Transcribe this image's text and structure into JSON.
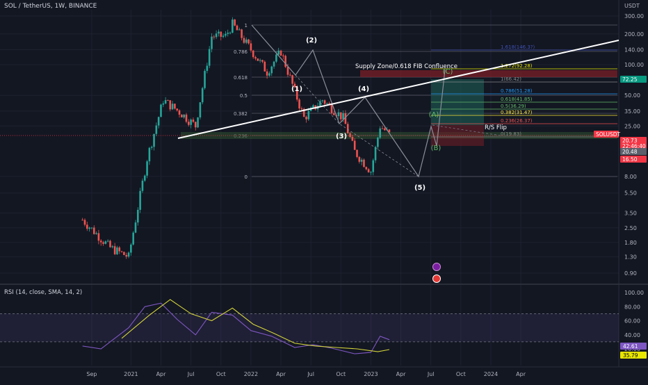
{
  "header": {
    "title": "SOL / TetherUS, 1W, BINANCE",
    "price_unit": "USDT",
    "rsi_title": "RSI (14, close, SMA, 14, 2)"
  },
  "colors": {
    "bg": "#131722",
    "grid": "#1e2230",
    "up": "#26a69a",
    "down": "#ef5350",
    "axis_text": "#b2b5be",
    "rsi_line": "#7e57c2",
    "rsi_ma": "#d4d43a",
    "trend": "#ffffff",
    "wave": "#8a8e99"
  },
  "chart_data": [
    {
      "type": "candlestick",
      "title": "SOL / TetherUS, 1W, BINANCE",
      "y_scale": "log",
      "ylim": [
        0.75,
        330
      ],
      "y_ticks": [
        "300.00",
        "200.00",
        "140.00",
        "100.00",
        "50.00",
        "35.00",
        "25.00",
        "8.00",
        "5.50",
        "3.50",
        "2.50",
        "1.80",
        "1.30",
        "0.90"
      ],
      "x_ticks": [
        "Sep",
        "2021",
        "Apr",
        "Jul",
        "Oct",
        "2022",
        "Apr",
        "Jul",
        "Oct",
        "2023",
        "Apr",
        "Jul",
        "Oct",
        "2024",
        "Apr"
      ],
      "key_prices": [
        {
          "t": "2020-08-10",
          "price": 3.0
        },
        {
          "t": "2020-11-02",
          "price": 1.6
        },
        {
          "t": "2020-12-28",
          "price": 1.3
        },
        {
          "t": "2021-01-18",
          "price": 3.0
        },
        {
          "t": "2021-02-22",
          "price": 12
        },
        {
          "t": "2021-04-12",
          "price": 45
        },
        {
          "t": "2021-06-07",
          "price": 33
        },
        {
          "t": "2021-07-19",
          "price": 25
        },
        {
          "t": "2021-09-06",
          "price": 190
        },
        {
          "t": "2021-10-18",
          "price": 190
        },
        {
          "t": "2021-11-08",
          "price": 250
        },
        {
          "t": "2022-01-03",
          "price": 140
        },
        {
          "t": "2022-02-21",
          "price": 85
        },
        {
          "t": "2022-04-04",
          "price": 135
        },
        {
          "t": "2022-06-13",
          "price": 30
        },
        {
          "t": "2022-08-08",
          "price": 45
        },
        {
          "t": "2022-10-10",
          "price": 30
        },
        {
          "t": "2022-11-14",
          "price": 14
        },
        {
          "t": "2023-01-02",
          "price": 9
        },
        {
          "t": "2023-01-30",
          "price": 25
        },
        {
          "t": "2023-02-27",
          "price": 20.73
        }
      ],
      "fib_retracement": [
        {
          "level": "1",
          "label": "1"
        },
        {
          "level": "0.786",
          "label": "0.786"
        },
        {
          "level": "0.618",
          "label": "0.618"
        },
        {
          "level": "0.5",
          "label": "0.5"
        },
        {
          "level": "0.382",
          "label": "0.382"
        },
        {
          "level": "0.236",
          "label": "0.236"
        },
        {
          "level": "0",
          "label": "0"
        }
      ],
      "fib_extension": [
        {
          "label": "1.618(146.3?)",
          "price": 146.3,
          "color": "#3f51b5"
        },
        {
          "label": "1.272(92.28)",
          "price": 92.28,
          "color": "#e6e600"
        },
        {
          "label": "1(66.42)",
          "price": 66.42,
          "color": "#888888"
        },
        {
          "label": "0.786(51.28)",
          "price": 51.28,
          "color": "#2196f3"
        },
        {
          "label": "0.618(41.85)",
          "price": 41.85,
          "color": "#66bb6a"
        },
        {
          "label": "0.5(36.29)",
          "price": 36.29,
          "color": "#66bb6a"
        },
        {
          "label": "0.382(31.47)",
          "price": 31.47,
          "color": "#ffeb3b"
        },
        {
          "label": "0.236(26.37)",
          "price": 26.37,
          "color": "#ef5350"
        },
        {
          "label": "0(19.83)",
          "price": 19.83,
          "color": "#888888"
        }
      ],
      "annotations": {
        "supply_zone": "Supply Zone/0.618 FIB Confluence",
        "rs_flip": "R/S Flip",
        "waves": [
          "(1)",
          "(2)",
          "(3)",
          "(4)",
          "(5)"
        ],
        "corrective": [
          "(A)",
          "(B)",
          "(C)"
        ]
      },
      "price_badges": [
        {
          "label": "72.25",
          "price": 72.25,
          "color": "#089981"
        },
        {
          "label": "SOLUSDT",
          "price": 21.5,
          "color": "#f23645"
        },
        {
          "label": "20.73",
          "price": 20.73,
          "color": "#f23645"
        },
        {
          "label": "22:46:40",
          "price": 20.73,
          "color": "#f23645"
        },
        {
          "label": "20.48",
          "price": 20.48,
          "color": "#5d606b"
        },
        {
          "label": "16.50",
          "price": 16.5,
          "color": "#f23645"
        }
      ]
    },
    {
      "type": "line",
      "title": "RSI (14, close, SMA, 14, 2)",
      "ylim": [
        0,
        100
      ],
      "y_ticks": [
        "100.00",
        "80.00",
        "60.00",
        "40.00",
        "20.00"
      ],
      "band": [
        30,
        70
      ],
      "series": [
        {
          "name": "RSI",
          "x": [
            "2020-08-10",
            "2020-10-05",
            "2020-12-28",
            "2021-02-15",
            "2021-04-05",
            "2021-05-24",
            "2021-07-19",
            "2021-09-06",
            "2021-11-08",
            "2022-01-03",
            "2022-03-07",
            "2022-05-16",
            "2022-07-11",
            "2022-09-05",
            "2022-11-14",
            "2023-01-02",
            "2023-01-30",
            "2023-02-27"
          ],
          "values": [
            24,
            20,
            50,
            80,
            85,
            62,
            40,
            72,
            68,
            46,
            38,
            22,
            26,
            21,
            13,
            15,
            38,
            33
          ]
        },
        {
          "name": "SMA",
          "x": [
            "2020-12-07",
            "2021-03-01",
            "2021-05-03",
            "2021-07-05",
            "2021-09-06",
            "2021-11-08",
            "2022-01-10",
            "2022-03-14",
            "2022-05-16",
            "2022-07-18",
            "2022-09-19",
            "2022-11-21",
            "2023-01-23",
            "2023-02-27"
          ],
          "values": [
            35,
            68,
            90,
            70,
            60,
            78,
            55,
            42,
            28,
            24,
            22,
            20,
            16,
            19
          ]
        }
      ],
      "last_values": [
        {
          "label": "42.61",
          "value": 42.61,
          "color": "#7e57c2"
        },
        {
          "label": "35.79",
          "value": 35.79,
          "color": "#e6e600"
        }
      ]
    }
  ]
}
